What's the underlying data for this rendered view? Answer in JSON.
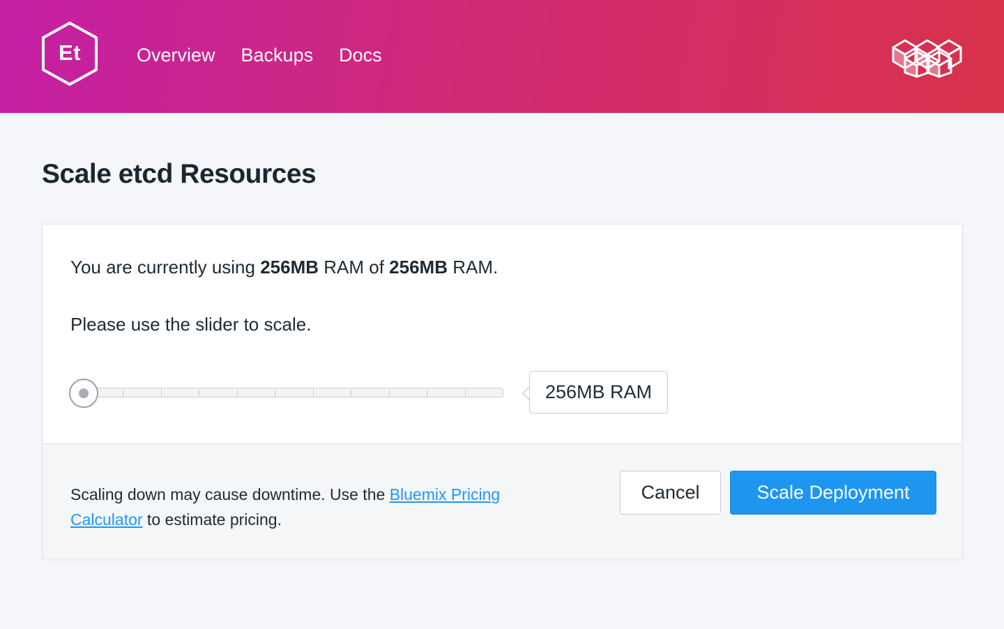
{
  "header": {
    "logo_text": "Et",
    "nav": [
      {
        "label": "Overview"
      },
      {
        "label": "Backups"
      },
      {
        "label": "Docs"
      }
    ]
  },
  "page": {
    "title": "Scale etcd Resources"
  },
  "card": {
    "usage": {
      "prefix": "You are currently using ",
      "current": "256MB",
      "middle": " RAM of ",
      "max": "256MB",
      "suffix": " RAM."
    },
    "instruction": "Please use the slider to scale.",
    "slider": {
      "value_label": "256MB RAM",
      "position": 0,
      "steps": 11
    },
    "footer": {
      "text_before": "Scaling down may cause downtime. Use the ",
      "link_text": "Bluemix Pricing Calculator",
      "text_after": " to estimate pricing.",
      "cancel_label": "Cancel",
      "scale_label": "Scale Deployment"
    }
  },
  "colors": {
    "header_gradient_start": "#c41fa6",
    "header_gradient_end": "#d8324a",
    "primary_button": "#1e96f0",
    "link": "#2196f3"
  }
}
